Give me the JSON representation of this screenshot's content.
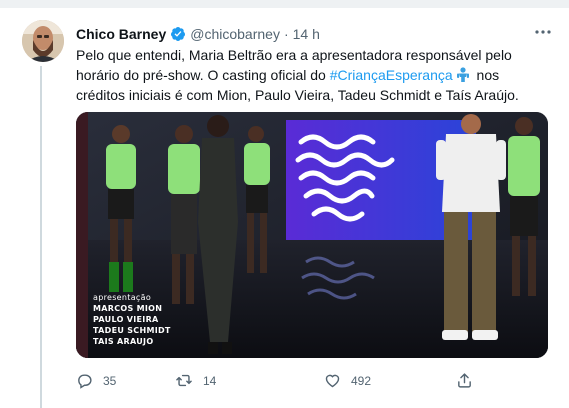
{
  "tweet": {
    "author_name": "Chico Barney",
    "author_handle": "@chicobarney",
    "separator": "·",
    "time": "14 h",
    "text_before_hashtag": "Pelo que entendi, Maria Beltrão era a apresentadora responsável pelo horário do pré-show. O casting oficial do ",
    "hashtag": "#CriançaEsperança",
    "text_after_hashtag": " nos créditos iniciais é com Mion, Paulo Vieira, Tadeu Schmidt e Taís Araújo."
  },
  "media": {
    "credits": {
      "label": "apresentação",
      "names": [
        "MARCOS MION",
        "PAULO VIEIRA",
        "TADEU SCHMIDT",
        "TAIS ARAUJO"
      ]
    }
  },
  "actions": {
    "reply_count": "35",
    "retweet_count": "14",
    "like_count": "492"
  },
  "icons": {
    "verified": "verified-badge-icon",
    "more": "more-options-icon",
    "reply": "reply-icon",
    "retweet": "retweet-icon",
    "like": "heart-icon",
    "share": "share-icon"
  },
  "colors": {
    "accent": "#1d9bf0",
    "secondary_text": "#536471",
    "primary_text": "#0f1419"
  }
}
